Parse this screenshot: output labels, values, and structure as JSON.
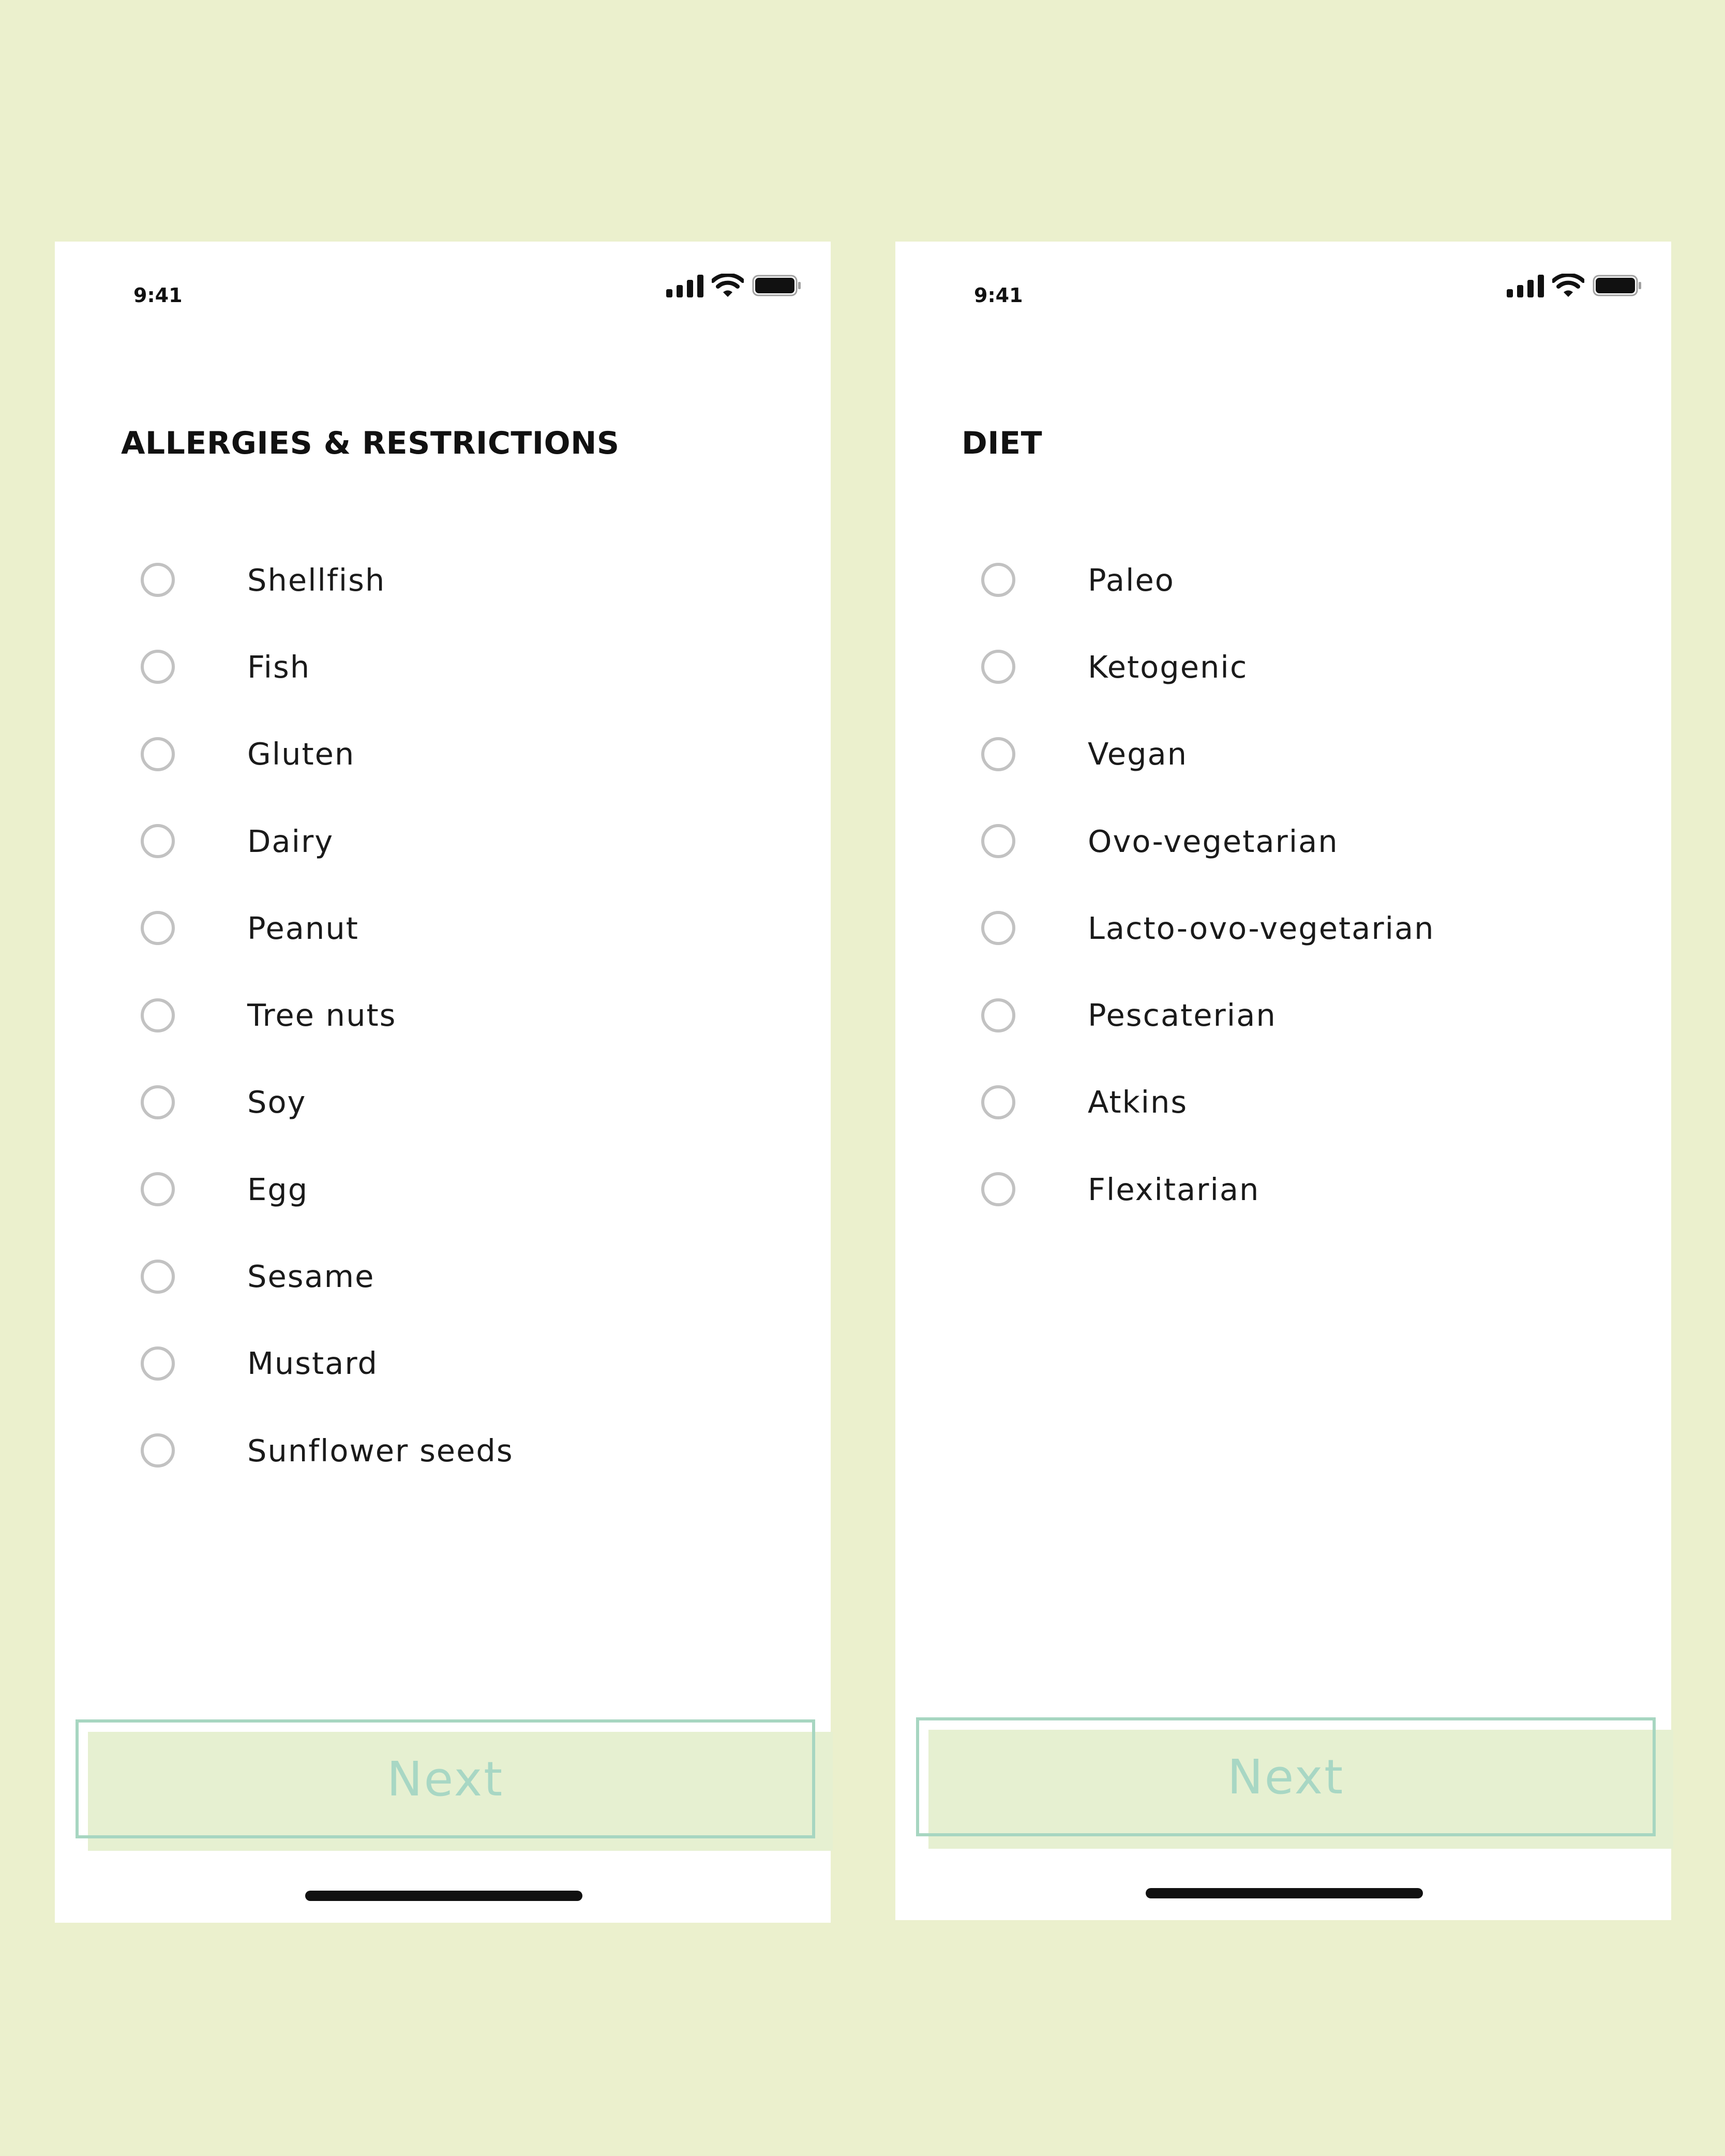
{
  "screens": [
    {
      "status": {
        "time": "9:41"
      },
      "title": "ALLERGIES & RESTRICTIONS",
      "options": [
        {
          "label": "Shellfish"
        },
        {
          "label": "Fish"
        },
        {
          "label": "Gluten"
        },
        {
          "label": "Dairy"
        },
        {
          "label": "Peanut"
        },
        {
          "label": "Tree nuts"
        },
        {
          "label": "Soy"
        },
        {
          "label": "Egg"
        },
        {
          "label": "Sesame"
        },
        {
          "label": "Mustard"
        },
        {
          "label": "Sunflower seeds"
        }
      ],
      "next_label": "Next"
    },
    {
      "status": {
        "time": "9:41"
      },
      "title": "DIET",
      "options": [
        {
          "label": "Paleo"
        },
        {
          "label": "Ketogenic"
        },
        {
          "label": "Vegan"
        },
        {
          "label": "Ovo-vegetarian"
        },
        {
          "label": "Lacto-ovo-vegetarian"
        },
        {
          "label": "Pescaterian"
        },
        {
          "label": "Atkins"
        },
        {
          "label": "Flexitarian"
        }
      ],
      "next_label": "Next"
    }
  ],
  "icons": {
    "signal": "signal-bars-icon",
    "wifi": "wifi-icon",
    "battery": "battery-icon"
  },
  "colors": {
    "background": "#ebf0cd",
    "screen": "#ffffff",
    "radio_border": "#c2c2c2",
    "button_fill": "#e6f0d1",
    "button_border": "#a7d6c1",
    "button_text": "#a8d7c4"
  }
}
